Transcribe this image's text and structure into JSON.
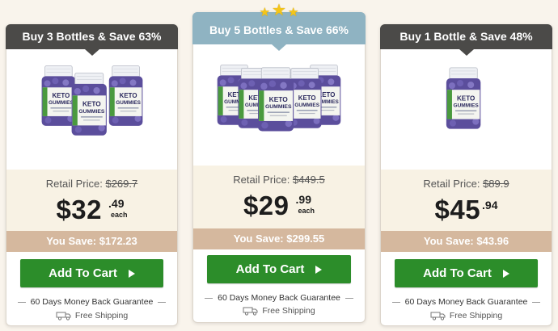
{
  "colors": {
    "header_dark": "#4b4a48",
    "header_featured": "#8fb3c2",
    "save_bar": "#d5b89e",
    "button": "#2c8d2a",
    "price_area": "#f8f2e4",
    "star": "#f5c518"
  },
  "packages": [
    {
      "header": "Buy 3 Bottles & Save 63%",
      "product_image": "keto-gummies-3-bottles",
      "retail_label": "Retail Price:",
      "retail_price": "$269.7",
      "price_dollars": "$32",
      "price_cents": ".49",
      "price_unit": "each",
      "you_save": "You Save: $172.23",
      "button_label": "Add To Cart",
      "guarantee": "60 Days Money Back Guarantee",
      "shipping": "Free Shipping"
    },
    {
      "header": "Buy 5 Bottles & Save 66%",
      "product_image": "keto-gummies-5-bottles",
      "stars": 3,
      "retail_label": "Retail Price:",
      "retail_price": "$449.5",
      "price_dollars": "$29",
      "price_cents": ".99",
      "price_unit": "each",
      "you_save": "You Save: $299.55",
      "button_label": "Add To Cart",
      "guarantee": "60 Days Money Back Guarantee",
      "shipping": "Free Shipping"
    },
    {
      "header": "Buy 1 Bottle & Save 48%",
      "product_image": "keto-gummies-1-bottle",
      "retail_label": "Retail Price:",
      "retail_price": "$89.9",
      "price_dollars": "$45",
      "price_cents": ".94",
      "you_save": "You Save: $43.96",
      "button_label": "Add To Cart",
      "guarantee": "60 Days Money Back Guarantee",
      "shipping": "Free Shipping"
    }
  ],
  "bottle": {
    "brand_line1": "KETO",
    "brand_line2": "GUMMIES",
    "side_text": "KETO"
  }
}
